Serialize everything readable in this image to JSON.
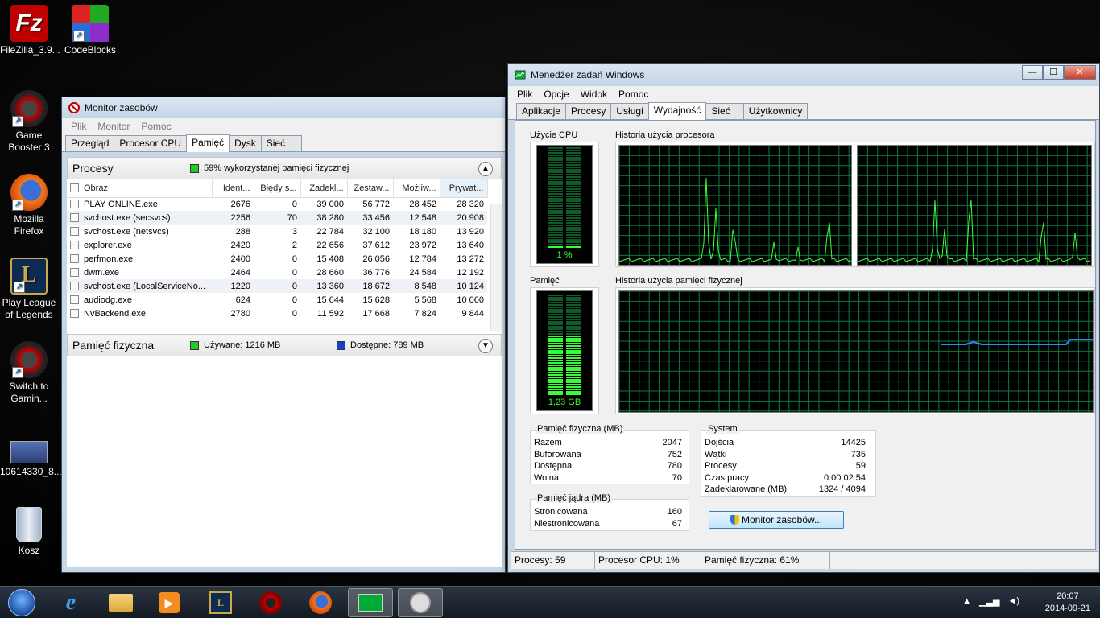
{
  "desktop": {
    "icons": [
      {
        "label": "FileZilla_3.9...",
        "icon": "filezilla-icon"
      },
      {
        "label": "CodeBlocks",
        "icon": "codeblocks-icon"
      },
      {
        "label": "Game Booster 3",
        "icon": "game-booster-icon"
      },
      {
        "label": "Mozilla Firefox",
        "icon": "firefox-icon"
      },
      {
        "label": "Play League of Legends",
        "icon": "league-icon"
      },
      {
        "label": "Switch to Gamin...",
        "icon": "switch-gaming-icon"
      },
      {
        "label": "10614330_8...",
        "icon": "image-file-icon"
      },
      {
        "label": "Kosz",
        "icon": "recycle-bin-icon"
      }
    ]
  },
  "resmon": {
    "title": "Monitor zasobów",
    "menu": [
      "Plik",
      "Monitor",
      "Pomoc"
    ],
    "tabs": [
      "Przegląd",
      "Procesor CPU",
      "Pamięć",
      "Dysk",
      "Sieć"
    ],
    "active_tab": "Pamięć",
    "processes": {
      "title": "Procesy",
      "summary": "59% wykorzystanej pamięci fizycznej",
      "summary_color": "#22cc22",
      "columns": [
        "Obraz",
        "Ident...",
        "Błędy s...",
        "Zadekl...",
        "Zestaw...",
        "Możliw...",
        "Prywat..."
      ],
      "rows": [
        [
          "PLAY ONLINE.exe",
          "2676",
          "0",
          "39 000",
          "56 772",
          "28 452",
          "28 320"
        ],
        [
          "svchost.exe (secsvcs)",
          "2256",
          "70",
          "38 280",
          "33 456",
          "12 548",
          "20 908"
        ],
        [
          "svchost.exe (netsvcs)",
          "288",
          "3",
          "22 784",
          "32 100",
          "18 180",
          "13 920"
        ],
        [
          "explorer.exe",
          "2420",
          "2",
          "22 656",
          "37 612",
          "23 972",
          "13 640"
        ],
        [
          "perfmon.exe",
          "2400",
          "0",
          "15 408",
          "26 056",
          "12 784",
          "13 272"
        ],
        [
          "dwm.exe",
          "2464",
          "0",
          "28 660",
          "36 776",
          "24 584",
          "12 192"
        ],
        [
          "svchost.exe (LocalServiceNo...",
          "1220",
          "0",
          "13 360",
          "18 672",
          "8 548",
          "10 124"
        ],
        [
          "audiodg.exe",
          "624",
          "0",
          "15 644",
          "15 628",
          "5 568",
          "10 060"
        ],
        [
          "NvBackend.exe",
          "2780",
          "0",
          "11 592",
          "17 668",
          "7 824",
          "9 844"
        ]
      ]
    },
    "physical": {
      "title": "Pamięć fizyczna",
      "used": "Używane: 1216 MB",
      "used_color": "#22cc22",
      "available": "Dostępne: 789 MB",
      "available_color": "#1a3fcc"
    }
  },
  "taskmgr": {
    "title": "Menedżer zadań Windows",
    "menu": [
      "Plik",
      "Opcje",
      "Widok",
      "Pomoc"
    ],
    "tabs": [
      "Aplikacje",
      "Procesy",
      "Usługi",
      "Wydajność",
      "Sieć",
      "Użytkownicy"
    ],
    "active_tab": "Wydajność",
    "cpu_usage_label": "Użycie CPU",
    "cpu_usage_value": "1 %",
    "cpu_usage_fraction": 0.01,
    "cpu_history_label": "Historia użycia procesora",
    "memory_label": "Pamięć",
    "memory_value": "1,23 GB",
    "memory_fraction": 0.6,
    "memory_history_label": "Historia użycia pamięci fizycznej",
    "physical_memory": {
      "title": "Pamięć fizyczna (MB)",
      "rows": [
        [
          "Razem",
          "2047"
        ],
        [
          "Buforowana",
          "752"
        ],
        [
          "Dostępna",
          "780"
        ],
        [
          "Wolna",
          "70"
        ]
      ]
    },
    "kernel_memory": {
      "title": "Pamięć jądra (MB)",
      "rows": [
        [
          "Stronicowana",
          "160"
        ],
        [
          "Niestronicowana",
          "67"
        ]
      ]
    },
    "system": {
      "title": "System",
      "rows": [
        [
          "Dojścia",
          "14425"
        ],
        [
          "Wątki",
          "735"
        ],
        [
          "Procesy",
          "59"
        ],
        [
          "Czas pracy",
          "0:00:02:54"
        ],
        [
          "Zadeklarowane (MB)",
          "1324 / 4094"
        ]
      ]
    },
    "resmon_button": "Monitor zasobów...",
    "status": [
      "Procesy: 59",
      "Procesor CPU: 1%",
      "Pamięć fizyczna: 61%"
    ]
  },
  "taskbar": {
    "clock_time": "20:07",
    "clock_date": "2014-09-21",
    "apps": [
      "start-icon",
      "ie-icon",
      "explorer-icon",
      "media-player-icon",
      "league-icon",
      "game-booster-icon",
      "firefox-icon",
      "task-manager-icon",
      "resource-monitor-icon"
    ]
  }
}
